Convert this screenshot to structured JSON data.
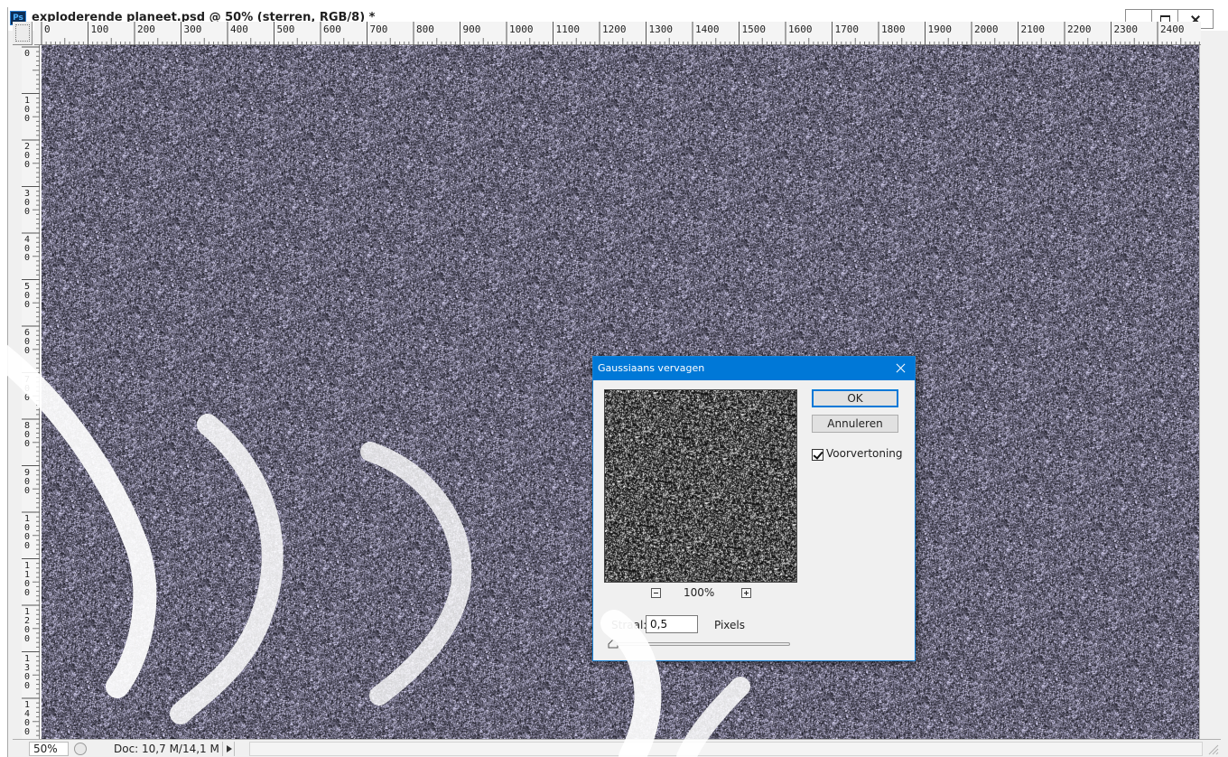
{
  "window": {
    "title": "exploderende planeet.psd @ 50% (sterren, RGB/8) *",
    "app_icon": "Ps"
  },
  "rulers": {
    "horizontal": [
      "0",
      "100",
      "200",
      "300",
      "400",
      "500",
      "600",
      "700",
      "800",
      "900",
      "1000",
      "1100",
      "1200",
      "1300",
      "1400",
      "1500",
      "1600",
      "1700",
      "1800",
      "1900",
      "2000",
      "2100",
      "2200",
      "2300",
      "2400"
    ],
    "vertical": [
      "0",
      "100",
      "200",
      "300",
      "400",
      "500",
      "600",
      "700",
      "800",
      "900",
      "1000",
      "1100",
      "1200",
      "1300",
      "1400"
    ]
  },
  "statusbar": {
    "zoom": "50%",
    "doc_size": "Doc: 10,7 M/14,1 M"
  },
  "dialog": {
    "title": "Gaussiaans vervagen",
    "ok_label": "OK",
    "cancel_label": "Annuleren",
    "preview_label": "Voorvertoning",
    "preview_checked": true,
    "zoom_pct": "100%",
    "radius_label": "Straal:",
    "radius_value": "0,5",
    "radius_unit": "Pixels"
  },
  "colors": {
    "dialog_title_bar": "#0078d7",
    "canvas_base": "#4a4658",
    "watermark": "#ffffff"
  },
  "icons": {
    "close": "close-icon",
    "minimize": "minimize-icon",
    "maximize": "maximize-icon",
    "zoom_in": "zoom-in-icon",
    "zoom_out": "zoom-out-icon"
  }
}
